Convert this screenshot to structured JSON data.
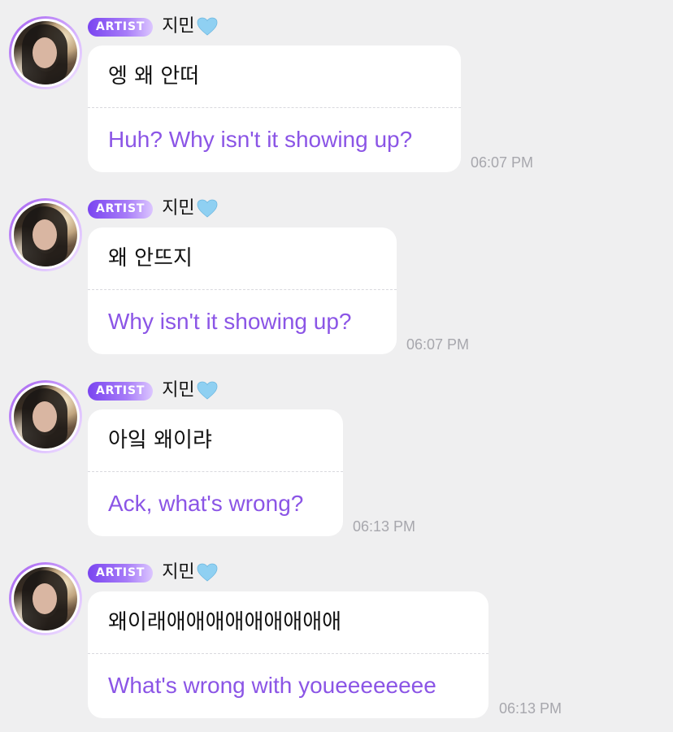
{
  "messages": [
    {
      "badge": "ARTIST",
      "sender": "지민",
      "heart_icon": "light-blue-heart-icon",
      "original": "엥 왜 안떠",
      "translation": "Huh? Why isn't it showing up?",
      "time": "06:07 PM"
    },
    {
      "badge": "ARTIST",
      "sender": "지민",
      "heart_icon": "light-blue-heart-icon",
      "original": "왜 안뜨지",
      "translation": "Why isn't it showing up?",
      "time": "06:07 PM"
    },
    {
      "badge": "ARTIST",
      "sender": "지민",
      "heart_icon": "light-blue-heart-icon",
      "original": "아잌 왜이랴",
      "translation": "Ack, what's wrong?",
      "time": "06:13 PM"
    },
    {
      "badge": "ARTIST",
      "sender": "지민",
      "heart_icon": "light-blue-heart-icon",
      "original": "왜이래애애애애애애애애애",
      "translation": "What's wrong with youeeeeeeee",
      "time": "06:13 PM"
    }
  ],
  "colors": {
    "background": "#efeff0",
    "bubble": "#ffffff",
    "translation_text": "#8b55e6",
    "badge_start": "#7a45f0",
    "badge_end": "#dcc6ff",
    "timestamp": "#a7a7ad",
    "heart": "#8fd0f2"
  }
}
